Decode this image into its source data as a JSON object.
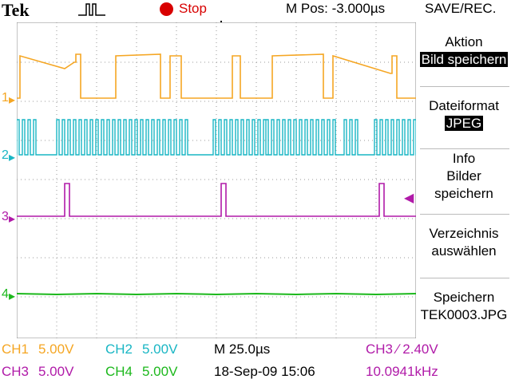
{
  "header": {
    "brand": "Tek",
    "acq_icon": "trigger-pulse-icon",
    "run_state": "Stop",
    "position": "M Pos: -3.000µs",
    "menu_title": "SAVE/REC."
  },
  "channel_markers": [
    "1",
    "2",
    "3",
    "4"
  ],
  "side_menu": [
    {
      "title": "Aktion",
      "value": "Bild speichern"
    },
    {
      "title": "Dateiformat",
      "value": "JPEG"
    },
    {
      "title": "Info",
      "lines": [
        "Bilder",
        "speichern"
      ]
    },
    {
      "title": "Verzeichnis",
      "lines": [
        "auswählen"
      ]
    },
    {
      "title": "Speichern",
      "lines": [
        "TEK0003.JPG"
      ]
    }
  ],
  "status": {
    "ch1": {
      "label": "CH1",
      "value": "5.00V"
    },
    "ch2": {
      "label": "CH2",
      "value": "5.00V"
    },
    "ch3": {
      "label": "CH3",
      "value": "5.00V"
    },
    "ch4": {
      "label": "CH4",
      "value": "5.00V"
    },
    "timebase": "M 25.0µs",
    "datetime": "18-Sep-09 15:06",
    "trigger": "CH3 ∕ 2.40V",
    "frequency": "10.0941kHz"
  },
  "colors": {
    "ch1": "#f5a623",
    "ch2": "#19b6c4",
    "ch3": "#b01aa8",
    "ch4": "#1cb81c",
    "stop": "#d80000"
  }
}
